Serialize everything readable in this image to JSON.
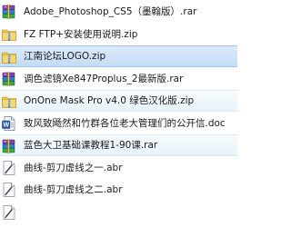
{
  "files": [
    {
      "name": "Adobe_Photoshop_CS5（墨翰版）.rar",
      "icon": "rar-archive-icon"
    },
    {
      "name": "FZ FTP+安装使用说明.zip",
      "icon": "zip-archive-icon"
    },
    {
      "name": "江南论坛LOGO.zip",
      "icon": "zip-archive-icon"
    },
    {
      "name": "调色滤镜Xe847Proplus_2最新版.rar",
      "icon": "rar-archive-icon"
    },
    {
      "name": "OnOne Mask Pro v4.0 绿色汉化版.zip",
      "icon": "zip-archive-icon"
    },
    {
      "name": "致风致飏然和竹群各位老大管理们的公开信.doc",
      "icon": "word-document-icon"
    },
    {
      "name": "蓝色大卫基础课教程1-90课.rar",
      "icon": "rar-archive-icon"
    },
    {
      "name": "曲线-剪刀虚线之一.abr",
      "icon": "abr-brush-icon"
    },
    {
      "name": "曲线-剪刀虚线之二.abr",
      "icon": "abr-brush-icon"
    },
    {
      "name": "",
      "icon": "abr-brush-icon"
    }
  ],
  "colors": {
    "selection": "#c4dcf6",
    "hover": "#e9f3fb",
    "text": "#1a1a1a",
    "zip_green": "#3aa635",
    "rar_purple": "#7c3c9a",
    "doc_blue": "#2a5bb0"
  }
}
